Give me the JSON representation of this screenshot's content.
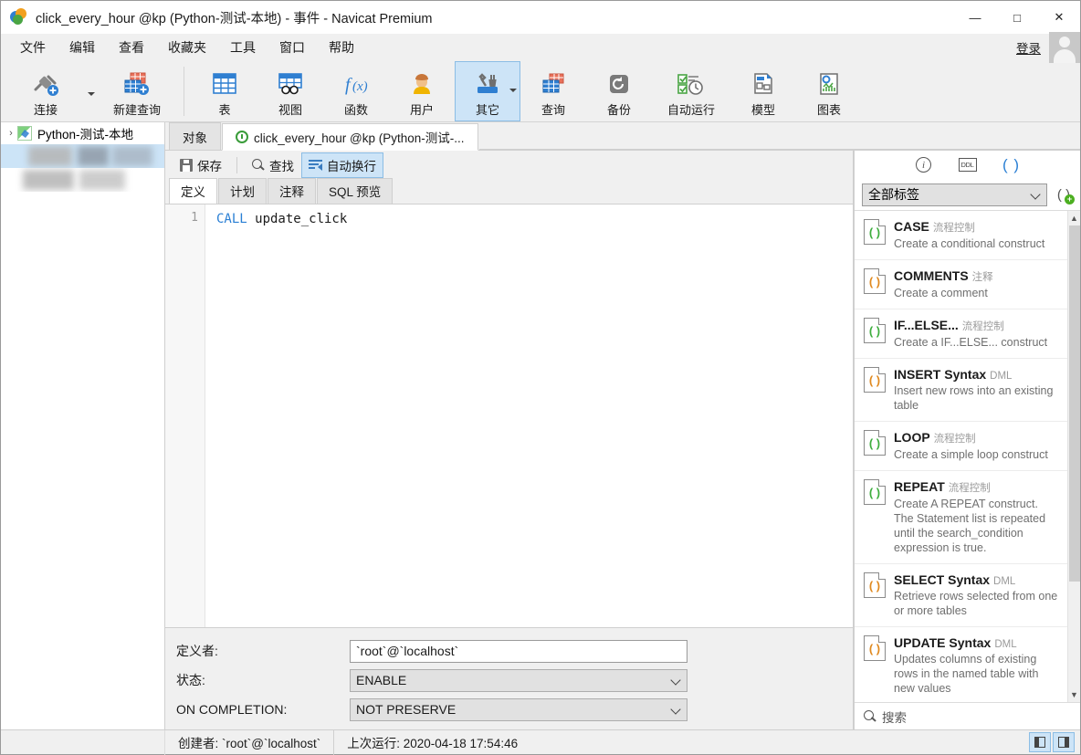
{
  "window": {
    "title": "click_every_hour @kp (Python-测试-本地) - 事件 - Navicat Premium",
    "logo_name": "navicat-logo",
    "minimize": "—",
    "maximize": "□",
    "close": "✕"
  },
  "menubar": {
    "items": [
      {
        "label": "文件"
      },
      {
        "label": "编辑"
      },
      {
        "label": "查看"
      },
      {
        "label": "收藏夹"
      },
      {
        "label": "工具"
      },
      {
        "label": "窗口"
      },
      {
        "label": "帮助"
      }
    ],
    "login_label": "登录"
  },
  "toolbar": {
    "groups": [
      {
        "items": [
          {
            "label": "连接",
            "icon": "connection-icon",
            "has_caret": true,
            "selected": false
          },
          {
            "label": "新建查询",
            "icon": "new-query-icon",
            "has_caret": false,
            "selected": false
          }
        ]
      },
      {
        "items": [
          {
            "label": "表",
            "icon": "table-icon",
            "has_caret": false,
            "selected": false
          },
          {
            "label": "视图",
            "icon": "view-icon",
            "has_caret": false,
            "selected": false
          },
          {
            "label": "函数",
            "icon": "function-icon",
            "has_caret": false,
            "selected": false
          },
          {
            "label": "用户",
            "icon": "user-icon",
            "has_caret": false,
            "selected": false
          },
          {
            "label": "其它",
            "icon": "other-tools-icon",
            "has_caret": true,
            "selected": true
          },
          {
            "label": "查询",
            "icon": "query-icon",
            "has_caret": false,
            "selected": false
          },
          {
            "label": "备份",
            "icon": "backup-icon",
            "has_caret": false,
            "selected": false
          },
          {
            "label": "自动运行",
            "icon": "automation-icon",
            "has_caret": false,
            "selected": false
          },
          {
            "label": "模型",
            "icon": "model-icon",
            "has_caret": false,
            "selected": false
          },
          {
            "label": "图表",
            "icon": "chart-icon",
            "has_caret": false,
            "selected": false
          }
        ]
      }
    ]
  },
  "sidebar": {
    "connection": {
      "label": "Python-测试-本地",
      "icon": "mysql-connection-icon",
      "expander": "›"
    },
    "redacted_rows": 2
  },
  "tabs": {
    "items": [
      {
        "label": "对象",
        "active": false,
        "icon": null
      },
      {
        "label": "click_every_hour @kp (Python-测试-...",
        "active": true,
        "icon": "event-clock-icon"
      }
    ]
  },
  "editor_toolbar": {
    "save_label": "保存",
    "find_label": "查找",
    "wrap_label": "自动换行",
    "wrap_active": true
  },
  "subtabs": {
    "items": [
      {
        "label": "定义",
        "active": true
      },
      {
        "label": "计划",
        "active": false
      },
      {
        "label": "注释",
        "active": false
      },
      {
        "label": "SQL 预览",
        "active": false
      }
    ]
  },
  "editor": {
    "line_number": "1",
    "keyword": "CALL",
    "rest": " update_click"
  },
  "form": {
    "rows": [
      {
        "label": "定义者:",
        "value": "`root`@`localhost`",
        "type": "text"
      },
      {
        "label": "状态:",
        "value": "ENABLE",
        "type": "select"
      },
      {
        "label": "ON COMPLETION:",
        "value": "NOT PRESERVE",
        "type": "select"
      }
    ]
  },
  "right_panel": {
    "icons": [
      {
        "name": "info-icon",
        "glyph": "i",
        "active": false
      },
      {
        "name": "ddl-icon",
        "glyph": "DDL",
        "active": false
      },
      {
        "name": "snippets-icon",
        "glyph": "( )",
        "active": true
      }
    ],
    "filter_value": "全部标签",
    "add_snippet_icon": "add-snippet-icon",
    "search_placeholder": "搜索",
    "snippets": [
      {
        "title": "CASE",
        "tag": "流程控制",
        "desc": "Create a conditional construct",
        "color": "#3fae3f"
      },
      {
        "title": "COMMENTS",
        "tag": "注释",
        "desc": "Create a comment",
        "color": "#e08a21"
      },
      {
        "title": "IF...ELSE...",
        "tag": "流程控制",
        "desc": "Create a IF...ELSE... construct",
        "color": "#3fae3f"
      },
      {
        "title": "INSERT Syntax",
        "tag": "DML",
        "desc": "Insert new rows into an existing table",
        "color": "#e08a21"
      },
      {
        "title": "LOOP",
        "tag": "流程控制",
        "desc": "Create a simple loop construct",
        "color": "#3fae3f"
      },
      {
        "title": "REPEAT",
        "tag": "流程控制",
        "desc": "Create A REPEAT construct. The Statement list is repeated until the search_condition expression is true.",
        "color": "#3fae3f"
      },
      {
        "title": "SELECT Syntax",
        "tag": "DML",
        "desc": "Retrieve rows selected from one or more tables",
        "color": "#e08a21"
      },
      {
        "title": "UPDATE Syntax",
        "tag": "DML",
        "desc": "Updates columns of existing rows in the named table with new values",
        "color": "#e08a21"
      }
    ]
  },
  "statusbar": {
    "creator": "创建者: `root`@`localhost`",
    "last_run": "上次运行: 2020-04-18 17:54:46",
    "toggle_left": "toggle-left-panel",
    "toggle_right": "toggle-right-panel"
  },
  "colors": {
    "accent": "#2a7fd4",
    "selected_bg": "#cde4f7",
    "selected_border": "#8bbde5",
    "chrome_bg": "#f0f0f0"
  }
}
